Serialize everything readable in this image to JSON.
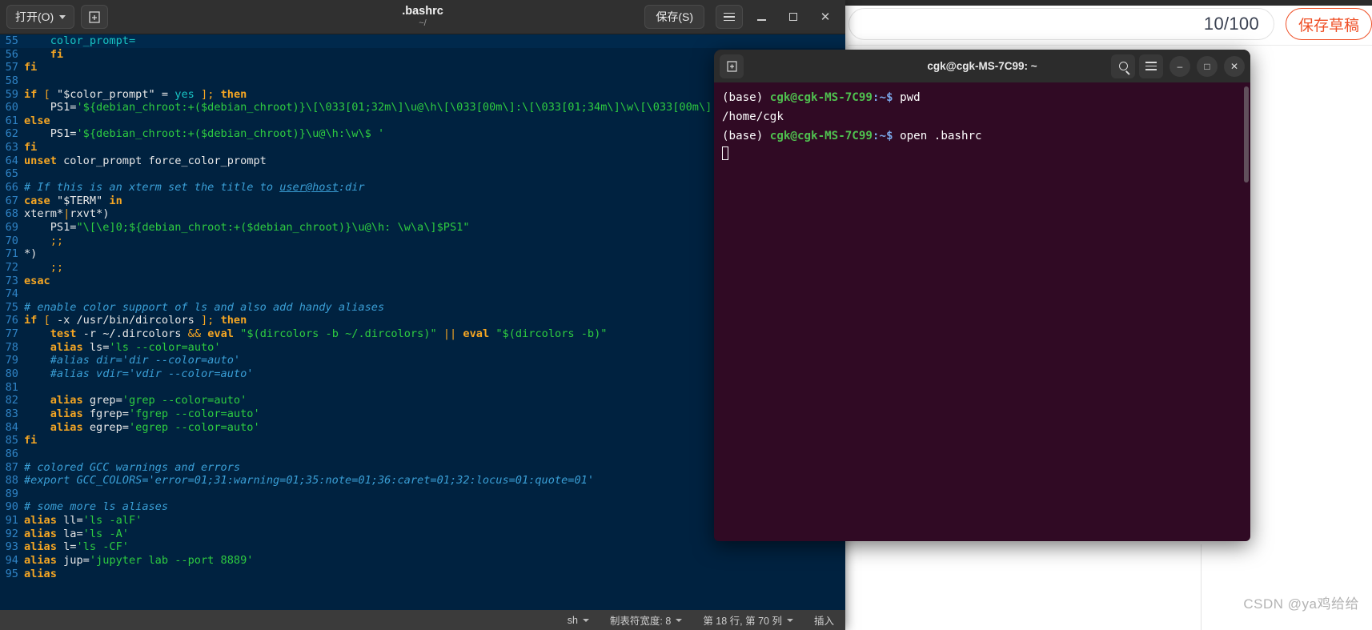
{
  "background_page": {
    "counter": "10/100",
    "save_draft_label": "保存草稿",
    "watermark": "CSDN @ya鸡给给"
  },
  "editor_window": {
    "open_button": "打开(O)",
    "new_tab_icon": "new-document-icon",
    "title": ".bashrc",
    "subtitle": "~/",
    "save_button": "保存(S)",
    "menu_icon": "hamburger-menu-icon",
    "window_controls": {
      "minimize": "–",
      "maximize": "□",
      "close": "✕"
    },
    "status_bar": {
      "language": "sh",
      "tab_width": "制表符宽度: 8",
      "position": "第 18 行, 第 70 列",
      "insert_mode": "插入"
    },
    "first_line": 55,
    "cursor_line": 55,
    "lines": [
      [
        [
          "    ",
          "t-def"
        ],
        [
          "color_prompt=",
          "t-var"
        ]
      ],
      [
        [
          "    ",
          "t-def"
        ],
        [
          "fi",
          "t-kw"
        ]
      ],
      [
        [
          "fi",
          "t-kw"
        ]
      ],
      [],
      [
        [
          "if",
          "t-kw"
        ],
        [
          " ",
          "t-def"
        ],
        [
          "[",
          "t-op"
        ],
        [
          " ",
          "t-def"
        ],
        [
          "\"$color_prompt\"",
          "t-def"
        ],
        [
          " ",
          "t-def"
        ],
        [
          "=",
          "t-def"
        ],
        [
          " ",
          "t-def"
        ],
        [
          "yes",
          "t-var"
        ],
        [
          " ",
          "t-def"
        ],
        [
          "];",
          "t-op"
        ],
        [
          " ",
          "t-def"
        ],
        [
          "then",
          "t-kw"
        ]
      ],
      [
        [
          "    PS1=",
          "t-def"
        ],
        [
          "'${debian_chroot:+($debian_chroot)}\\[\\033[01;32m\\]\\u@\\h\\[\\033[00m\\]:\\[\\033[01;34m\\]\\w\\[\\033[00m\\]",
          "t-str"
        ]
      ],
      [
        [
          "else",
          "t-kw"
        ]
      ],
      [
        [
          "    PS1=",
          "t-def"
        ],
        [
          "'${debian_chroot:+($debian_chroot)}\\u@\\h:\\w\\$ '",
          "t-str"
        ]
      ],
      [
        [
          "fi",
          "t-kw"
        ]
      ],
      [
        [
          "unset",
          "t-kw"
        ],
        [
          " color_prompt force_color_prompt",
          "t-def"
        ]
      ],
      [],
      [
        [
          "# If this is an xterm set the title to ",
          "t-cmt"
        ],
        [
          "user@host",
          "t-link"
        ],
        [
          ":dir",
          "t-cmt"
        ]
      ],
      [
        [
          "case",
          "t-kw"
        ],
        [
          " ",
          "t-def"
        ],
        [
          "\"$TERM\"",
          "t-def"
        ],
        [
          " ",
          "t-def"
        ],
        [
          "in",
          "t-kw"
        ]
      ],
      [
        [
          "xterm*",
          "t-def"
        ],
        [
          "|",
          "t-op"
        ],
        [
          "rxvt*)",
          "t-def"
        ]
      ],
      [
        [
          "    PS1=",
          "t-def"
        ],
        [
          "\"\\[\\e]0;${debian_chroot:+($debian_chroot)}\\u@\\h: \\w\\a\\]$PS1\"",
          "t-str"
        ]
      ],
      [
        [
          "    ",
          "t-def"
        ],
        [
          ";;",
          "t-op"
        ]
      ],
      [
        [
          "*)",
          "t-def"
        ]
      ],
      [
        [
          "    ",
          "t-def"
        ],
        [
          ";;",
          "t-op"
        ]
      ],
      [
        [
          "esac",
          "t-kw"
        ]
      ],
      [],
      [
        [
          "# enable color support of ls and also add handy aliases",
          "t-cmt"
        ]
      ],
      [
        [
          "if",
          "t-kw"
        ],
        [
          " ",
          "t-def"
        ],
        [
          "[",
          "t-op"
        ],
        [
          " ",
          "t-def"
        ],
        [
          "-x",
          "t-def"
        ],
        [
          " /usr/bin/dircolors ",
          "t-def"
        ],
        [
          "];",
          "t-op"
        ],
        [
          " ",
          "t-def"
        ],
        [
          "then",
          "t-kw"
        ]
      ],
      [
        [
          "    ",
          "t-def"
        ],
        [
          "test",
          "t-kw"
        ],
        [
          " -r ~/.dircolors ",
          "t-def"
        ],
        [
          "&&",
          "t-op"
        ],
        [
          " ",
          "t-def"
        ],
        [
          "eval",
          "t-kw"
        ],
        [
          " ",
          "t-def"
        ],
        [
          "\"$(dircolors -b ~/.dircolors)\"",
          "t-str"
        ],
        [
          " ",
          "t-def"
        ],
        [
          "||",
          "t-op"
        ],
        [
          " ",
          "t-def"
        ],
        [
          "eval",
          "t-kw"
        ],
        [
          " ",
          "t-def"
        ],
        [
          "\"$(dircolors -b)\"",
          "t-str"
        ]
      ],
      [
        [
          "    ",
          "t-def"
        ],
        [
          "alias",
          "t-kw"
        ],
        [
          " ls=",
          "t-def"
        ],
        [
          "'ls --color=auto'",
          "t-str"
        ]
      ],
      [
        [
          "    ",
          "t-def"
        ],
        [
          "#alias dir='dir --color=auto'",
          "t-cmt"
        ]
      ],
      [
        [
          "    ",
          "t-def"
        ],
        [
          "#alias vdir='vdir --color=auto'",
          "t-cmt"
        ]
      ],
      [],
      [
        [
          "    ",
          "t-def"
        ],
        [
          "alias",
          "t-kw"
        ],
        [
          " grep=",
          "t-def"
        ],
        [
          "'grep --color=auto'",
          "t-str"
        ]
      ],
      [
        [
          "    ",
          "t-def"
        ],
        [
          "alias",
          "t-kw"
        ],
        [
          " fgrep=",
          "t-def"
        ],
        [
          "'fgrep --color=auto'",
          "t-str"
        ]
      ],
      [
        [
          "    ",
          "t-def"
        ],
        [
          "alias",
          "t-kw"
        ],
        [
          " egrep=",
          "t-def"
        ],
        [
          "'egrep --color=auto'",
          "t-str"
        ]
      ],
      [
        [
          "fi",
          "t-kw"
        ]
      ],
      [],
      [
        [
          "# colored GCC warnings and errors",
          "t-cmt"
        ]
      ],
      [
        [
          "#export GCC_COLORS='error=01;31:warning=01;35:note=01;36:caret=01;32:locus=01:quote=01'",
          "t-cmt"
        ]
      ],
      [],
      [
        [
          "# some more ls aliases",
          "t-cmt"
        ]
      ],
      [
        [
          "alias",
          "t-kw"
        ],
        [
          " ll=",
          "t-def"
        ],
        [
          "'ls -alF'",
          "t-str"
        ]
      ],
      [
        [
          "alias",
          "t-kw"
        ],
        [
          " la=",
          "t-def"
        ],
        [
          "'ls -A'",
          "t-str"
        ]
      ],
      [
        [
          "alias",
          "t-kw"
        ],
        [
          " l=",
          "t-def"
        ],
        [
          "'ls -CF'",
          "t-str"
        ]
      ],
      [
        [
          "alias",
          "t-kw"
        ],
        [
          " jup=",
          "t-def"
        ],
        [
          "'jupyter lab --port 8889'",
          "t-str"
        ]
      ],
      [
        [
          "alias",
          "t-kw"
        ],
        [
          " ",
          "t-def"
        ],
        [
          "",
          "t-def"
        ]
      ]
    ]
  },
  "terminal_window": {
    "new_tab_icon": "new-tab-icon",
    "title": "cgk@cgk-MS-7C99: ~",
    "search_icon": "search-icon",
    "menu_icon": "hamburger-menu-icon",
    "window_controls": {
      "minimize": "–",
      "maximize": "□",
      "close": "✕"
    },
    "lines": [
      {
        "prompt_env": "(base)",
        "prompt_user": "cgk@cgk-MS-7C99",
        "prompt_sep": ":~$",
        "command": " pwd"
      },
      {
        "output": "/home/cgk"
      },
      {
        "prompt_env": "(base)",
        "prompt_user": "cgk@cgk-MS-7C99",
        "prompt_sep": ":~$",
        "command": " open .bashrc"
      },
      {
        "cursor": true
      }
    ]
  }
}
